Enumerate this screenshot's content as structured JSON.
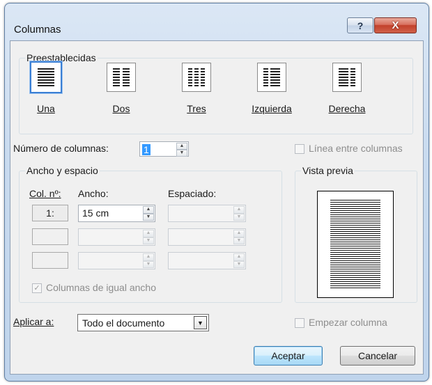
{
  "window": {
    "title": "Columnas",
    "help_glyph": "?",
    "close_glyph": "X"
  },
  "presets": {
    "group_label": "Preestablecidas",
    "items": [
      {
        "key": "una",
        "label": "Una",
        "selected": true
      },
      {
        "key": "dos",
        "label": "Dos",
        "selected": false
      },
      {
        "key": "tres",
        "label": "Tres",
        "selected": false
      },
      {
        "key": "izquierda",
        "label": "Izquierda",
        "selected": false
      },
      {
        "key": "derecha",
        "label": "Derecha",
        "selected": false
      }
    ]
  },
  "num_columns": {
    "label": "Número de columnas:",
    "value": "1"
  },
  "line_between": {
    "label": "Línea entre columnas",
    "checked": false,
    "enabled": false
  },
  "width_spacing": {
    "group_label": "Ancho y espacio",
    "col_header": "Col. nº:",
    "width_header": "Ancho:",
    "spacing_header": "Espaciado:",
    "rows": [
      {
        "col": "1:",
        "width": "15 cm",
        "spacing": ""
      },
      {
        "col": "",
        "width": "",
        "spacing": ""
      },
      {
        "col": "",
        "width": "",
        "spacing": ""
      }
    ],
    "equal_width": {
      "label": "Columnas de igual ancho",
      "checked": true,
      "enabled": false
    }
  },
  "preview": {
    "group_label": "Vista previa"
  },
  "apply_to": {
    "label": "Aplicar a:",
    "value": "Todo el documento"
  },
  "start_column": {
    "label": "Empezar columna",
    "checked": false,
    "enabled": false
  },
  "buttons": {
    "ok": "Aceptar",
    "cancel": "Cancelar"
  },
  "colors": {
    "accent": "#3a7fd4",
    "disabled_text": "#8d8d8d"
  }
}
